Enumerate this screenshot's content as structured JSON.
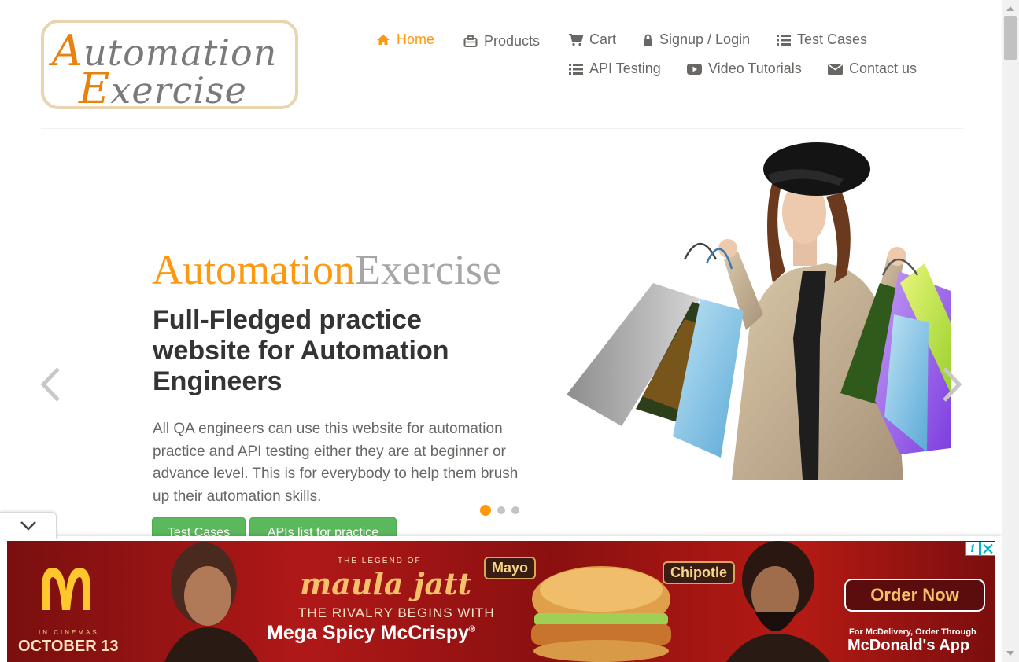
{
  "logo": {
    "line1_cap": "A",
    "line1_rest": "utomation",
    "line2_cap": "E",
    "line2_rest": "xercise"
  },
  "nav": {
    "items": [
      {
        "label": "Home",
        "icon": "home-icon",
        "active": true
      },
      {
        "label": "Products",
        "icon": "briefcase-icon"
      },
      {
        "label": "Cart",
        "icon": "cart-icon"
      },
      {
        "label": "Signup / Login",
        "icon": "lock-icon"
      },
      {
        "label": "Test Cases",
        "icon": "list-icon"
      },
      {
        "label": "API Testing",
        "icon": "list-icon"
      },
      {
        "label": "Video Tutorials",
        "icon": "youtube-play-icon"
      },
      {
        "label": "Contact us",
        "icon": "envelope-icon"
      }
    ]
  },
  "slider": {
    "brand_part1": "Automation",
    "brand_part2": "Exercise",
    "headline": "Full-Fledged practice website for Automation Engineers",
    "description": "All QA engineers can use this website for automation practice and API testing either they are at beginner or advance level. This is for everybody to help them brush up their automation skills.",
    "buttons": {
      "test_cases": "Test Cases",
      "apis_list": "APIs list for practice"
    },
    "active_slide": 1,
    "slide_count": 3
  },
  "ad": {
    "in_cinemas": "IN CINEMAS",
    "release_date": "OCTOBER 13",
    "legend_of": "THE LEGEND OF",
    "movie_title": "maula jatt",
    "rivalry": "THE RIVALRY BEGINS WITH",
    "product": "Mega Spicy McCrispy",
    "sauce_1": "Mayo",
    "sauce_2": "Chipotle",
    "cta": "Order Now",
    "via": "For McDelivery, Order Through",
    "app": "McDonald's App"
  },
  "colors": {
    "accent": "#FE980F",
    "brand_grey": "#A6A6A6",
    "button_green": "#5CB85C",
    "text": "#696763",
    "headline": "#363432"
  }
}
